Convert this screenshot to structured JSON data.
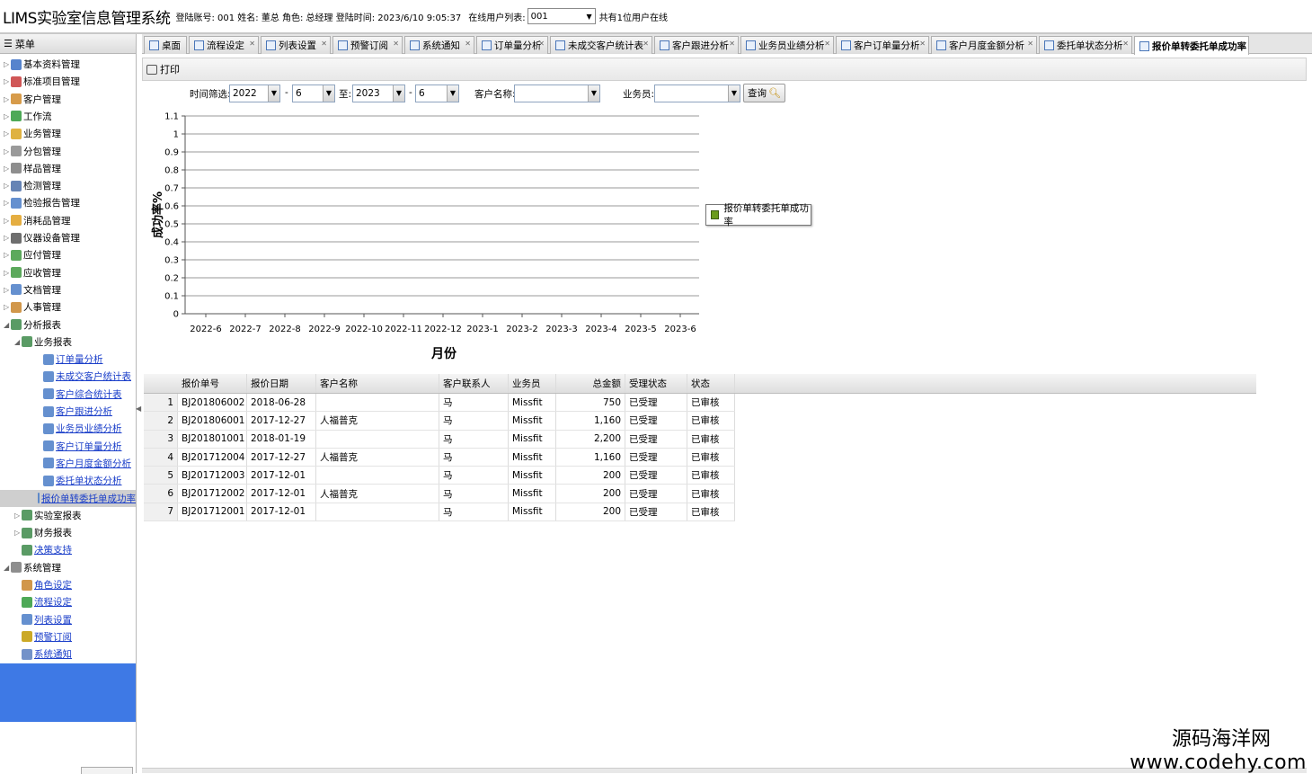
{
  "header": {
    "app_title": "LIMS实验室信息管理系统",
    "login_info": "登陆账号: 001 姓名: 董总 角色: 总经理 登陆时间: 2023/6/10 9:05:37",
    "online_users_label": "在线用户列表:",
    "online_users_value": "001",
    "online_count": "共有1位用户在线"
  },
  "sidebar": {
    "title": "菜单",
    "items": [
      {
        "label": "基本资料管理",
        "level": 0,
        "icon": "book-icon",
        "link": false
      },
      {
        "label": "标准项目管理",
        "level": 0,
        "icon": "flag-icon",
        "link": false
      },
      {
        "label": "客户管理",
        "level": 0,
        "icon": "user-icon",
        "link": false
      },
      {
        "label": "工作流",
        "level": 0,
        "icon": "workflow-icon",
        "link": false
      },
      {
        "label": "业务管理",
        "level": 0,
        "icon": "folder-icon",
        "link": false
      },
      {
        "label": "分包管理",
        "level": 0,
        "icon": "house-icon",
        "link": false
      },
      {
        "label": "样品管理",
        "level": 0,
        "icon": "gear-icon",
        "link": false
      },
      {
        "label": "检测管理",
        "level": 0,
        "icon": "monitor-icon",
        "link": false
      },
      {
        "label": "检验报告管理",
        "level": 0,
        "icon": "document-icon",
        "link": false
      },
      {
        "label": "消耗品管理",
        "level": 0,
        "icon": "box-icon",
        "link": false
      },
      {
        "label": "仪器设备管理",
        "level": 0,
        "icon": "instrument-icon",
        "link": false
      },
      {
        "label": "应付管理",
        "level": 0,
        "icon": "payable-icon",
        "link": false
      },
      {
        "label": "应收管理",
        "level": 0,
        "icon": "receivable-icon",
        "link": false
      },
      {
        "label": "文档管理",
        "level": 0,
        "icon": "file-icon",
        "link": false
      },
      {
        "label": "人事管理",
        "level": 0,
        "icon": "people-icon",
        "link": false
      },
      {
        "label": "分析报表",
        "level": 0,
        "icon": "report-icon",
        "link": false,
        "expanded": true
      },
      {
        "label": "业务报表",
        "level": 1,
        "icon": "report-icon",
        "link": false,
        "expanded": true
      },
      {
        "label": "订单量分析",
        "level": 2,
        "icon": "sheet-icon",
        "link": true
      },
      {
        "label": "未成交客户统计表",
        "level": 2,
        "icon": "sheet-icon",
        "link": true
      },
      {
        "label": "客户综合统计表",
        "level": 2,
        "icon": "sheet-icon",
        "link": true
      },
      {
        "label": "客户跟进分析",
        "level": 2,
        "icon": "sheet-icon",
        "link": true
      },
      {
        "label": "业务员业绩分析",
        "level": 2,
        "icon": "sheet-icon",
        "link": true
      },
      {
        "label": "客户订单量分析",
        "level": 2,
        "icon": "sheet-icon",
        "link": true
      },
      {
        "label": "客户月度金额分析",
        "level": 2,
        "icon": "sheet-icon",
        "link": true
      },
      {
        "label": "委托单状态分析",
        "level": 2,
        "icon": "sheet-icon",
        "link": true
      },
      {
        "label": "报价单转委托单成功率",
        "level": 2,
        "icon": "sheet-icon",
        "link": true,
        "selected": true
      },
      {
        "label": "实验室报表",
        "level": 1,
        "icon": "report-icon",
        "link": false
      },
      {
        "label": "财务报表",
        "level": 1,
        "icon": "report-icon",
        "link": false
      },
      {
        "label": "决策支持",
        "level": 1,
        "icon": "report-icon",
        "link": true
      },
      {
        "label": "系统管理",
        "level": 0,
        "icon": "gear-icon",
        "link": false,
        "expanded": true
      },
      {
        "label": "角色设定",
        "level": 1,
        "icon": "role-icon",
        "link": true
      },
      {
        "label": "流程设定",
        "level": 1,
        "icon": "workflow-icon",
        "link": true
      },
      {
        "label": "列表设置",
        "level": 1,
        "icon": "document-icon",
        "link": true
      },
      {
        "label": "预警订阅",
        "level": 1,
        "icon": "magnifier-icon",
        "link": true
      },
      {
        "label": "系统通知",
        "level": 1,
        "icon": "mail-icon",
        "link": true
      }
    ]
  },
  "tabs": [
    {
      "label": "桌面",
      "icon": "home-icon",
      "closable": false
    },
    {
      "label": "流程设定",
      "icon": "workflow-icon",
      "closable": true
    },
    {
      "label": "列表设置",
      "icon": "document-icon",
      "closable": true
    },
    {
      "label": "预警订阅",
      "icon": "magnifier-icon",
      "closable": true
    },
    {
      "label": "系统通知",
      "icon": "mail-icon",
      "closable": true
    },
    {
      "label": "订单量分析",
      "icon": "sheet-icon",
      "closable": true
    },
    {
      "label": "未成交客户统计表",
      "icon": "sheet-icon",
      "closable": true
    },
    {
      "label": "客户跟进分析",
      "icon": "sheet-icon",
      "closable": true
    },
    {
      "label": "业务员业绩分析",
      "icon": "sheet-icon",
      "closable": true
    },
    {
      "label": "客户订单量分析",
      "icon": "sheet-icon",
      "closable": true
    },
    {
      "label": "客户月度金额分析",
      "icon": "sheet-icon",
      "closable": true
    },
    {
      "label": "委托单状态分析",
      "icon": "sheet-icon",
      "closable": true
    },
    {
      "label": "报价单转委托单成功率",
      "icon": "sheet-icon",
      "closable": true,
      "active": true
    }
  ],
  "toolbar": {
    "print_label": "打印"
  },
  "filters": {
    "time_label": "时间筛选:",
    "from_year": "2022",
    "from_month": "6",
    "to_label": "至:",
    "to_year": "2023",
    "to_month": "6",
    "dash": "-",
    "customer_label": "客户名称:",
    "customer_value": "",
    "salesman_label": "业务员:",
    "salesman_value": "",
    "query_label": "查询"
  },
  "chart_data": {
    "type": "line",
    "title": "",
    "xlabel": "月份",
    "ylabel": "成功率%",
    "categories": [
      "2022-6",
      "2022-7",
      "2022-8",
      "2022-9",
      "2022-10",
      "2022-11",
      "2022-12",
      "2023-1",
      "2023-2",
      "2023-3",
      "2023-4",
      "2023-5",
      "2023-6"
    ],
    "yticks": [
      "0",
      "0.1",
      "0.2",
      "0.3",
      "0.4",
      "0.5",
      "0.6",
      "0.7",
      "0.8",
      "0.9",
      "1",
      "1.1"
    ],
    "ylim": [
      0,
      1.1
    ],
    "series": [
      {
        "name": "报价单转委托单成功率",
        "values": [],
        "color": "#6a9b1c"
      }
    ],
    "grid": true,
    "legend_position": "right"
  },
  "table": {
    "columns": [
      "报价单号",
      "报价日期",
      "客户名称",
      "客户联系人",
      "业务员",
      "总金额",
      "受理状态",
      "状态"
    ],
    "rows": [
      [
        "BJ201806002",
        "2018-06-28",
        "",
        "马",
        "Missfit",
        "750",
        "已受理",
        "已审核"
      ],
      [
        "BJ201806001",
        "2017-12-27",
        "人福普克",
        "马",
        "Missfit",
        "1,160",
        "已受理",
        "已审核"
      ],
      [
        "BJ201801001",
        "2018-01-19",
        "",
        "马",
        "Missfit",
        "2,200",
        "已受理",
        "已审核"
      ],
      [
        "BJ201712004",
        "2017-12-27",
        "人福普克",
        "马",
        "Missfit",
        "1,160",
        "已受理",
        "已审核"
      ],
      [
        "BJ201712003",
        "2017-12-01",
        "",
        "马",
        "Missfit",
        "200",
        "已受理",
        "已审核"
      ],
      [
        "BJ201712002",
        "2017-12-01",
        "人福普克",
        "马",
        "Missfit",
        "200",
        "已受理",
        "已审核"
      ],
      [
        "BJ201712001",
        "2017-12-01",
        "",
        "马",
        "Missfit",
        "200",
        "已受理",
        "已审核"
      ]
    ]
  },
  "watermark": {
    "line1": "源码海洋网",
    "line2": "www.codehy.com"
  }
}
